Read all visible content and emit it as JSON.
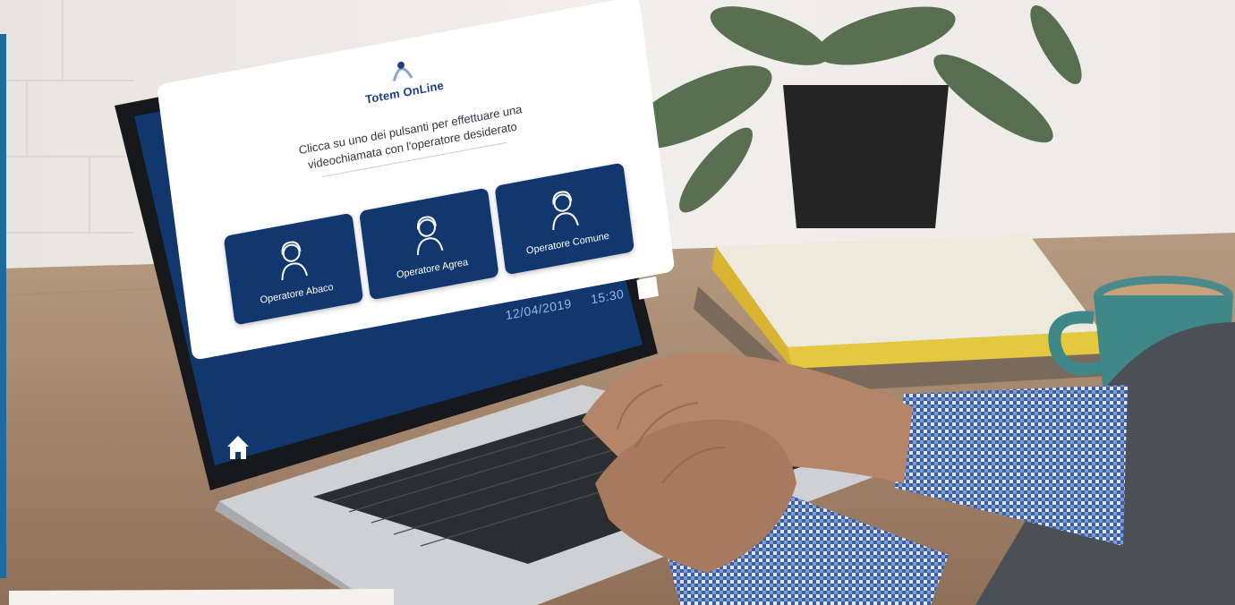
{
  "screen": {
    "logo_title": "Totem OnLine",
    "logo_subtitle": "",
    "instruction": "Clicca su uno dei pulsanti per effettuare una videochiamata con l'operatore desiderato",
    "buttons": [
      {
        "label": "Operatore Abaco",
        "icon": "operator-icon"
      },
      {
        "label": "Operatore Agrea",
        "icon": "operator-icon"
      },
      {
        "label": "Operatore Comune",
        "icon": "operator-icon"
      }
    ],
    "date": "12/04/2019",
    "time": "15:30",
    "home_icon": "home-icon"
  },
  "colors": {
    "screen_frame": "#12376f",
    "button": "#12376f",
    "accent_bar": "#1d6aa0"
  }
}
